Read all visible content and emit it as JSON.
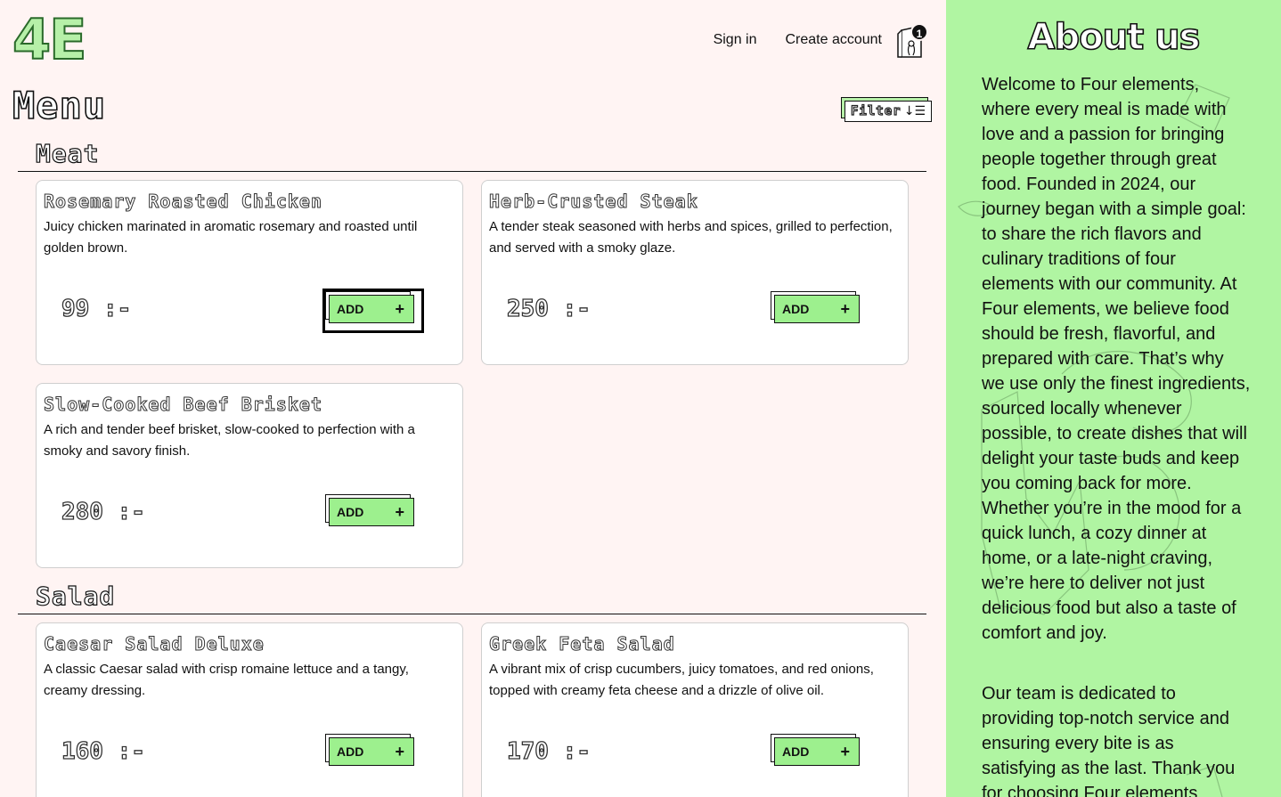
{
  "brand": {
    "logo": "4E"
  },
  "nav": {
    "sign_in": "Sign in",
    "create_account": "Create account",
    "cart_count": "1"
  },
  "menu": {
    "title": "Menu",
    "filter_label": "Filter",
    "filter_icon": "sort-icon"
  },
  "colors": {
    "background": "#fff4f3",
    "accent_green": "#9df08e",
    "aside_green": "#b0f5a2"
  },
  "sections": [
    {
      "title": "Meat",
      "items": [
        {
          "name": "Rosemary Roasted Chicken",
          "desc": "Juicy chicken marinated in aromatic rosemary and roasted until golden brown.",
          "price": "99 :-",
          "add": "ADD"
        },
        {
          "name": "Herb-Crusted Steak",
          "desc": "A tender steak seasoned with herbs and spices, grilled to perfection, and served with a smoky glaze.",
          "price": "250 :-",
          "add": "ADD"
        },
        {
          "name": "Slow-Cooked Beef Brisket",
          "desc": "A rich and tender beef brisket, slow-cooked to perfection with a smoky and savory finish.",
          "price": "280 :-",
          "add": "ADD"
        }
      ]
    },
    {
      "title": "Salad",
      "items": [
        {
          "name": "Caesar Salad Deluxe",
          "desc": "A classic Caesar salad with crisp romaine lettuce and a tangy, creamy dressing.",
          "price": "160 :-",
          "add": "ADD"
        },
        {
          "name": "Greek Feta Salad",
          "desc": "A vibrant mix of crisp cucumbers, juicy tomatoes, and red onions, topped with creamy feta cheese and a drizzle of olive oil.",
          "price": "170 :-",
          "add": "ADD"
        }
      ]
    }
  ],
  "about": {
    "title": "About us",
    "p1": "Welcome to Four elements, where every meal is made with love and a passion for bringing people together through great food. Founded in 2024, our journey began with a simple goal: to share the rich flavors and culinary traditions of four elements with our community. At Four elements, we believe food should be fresh, flavorful, and prepared with care. That’s why we use only the finest ingredients, sourced locally whenever possible, to create dishes that will delight your taste buds and keep you coming back for more. Whether you’re in the mood for a quick lunch, a cozy dinner at home, or a late-night craving, we’re here to deliver not just delicious food but also a taste of comfort and joy.",
    "p2": "Our team is dedicated to providing top-notch service and ensuring every bite is as satisfying as the last. Thank you for choosing Four elements"
  }
}
